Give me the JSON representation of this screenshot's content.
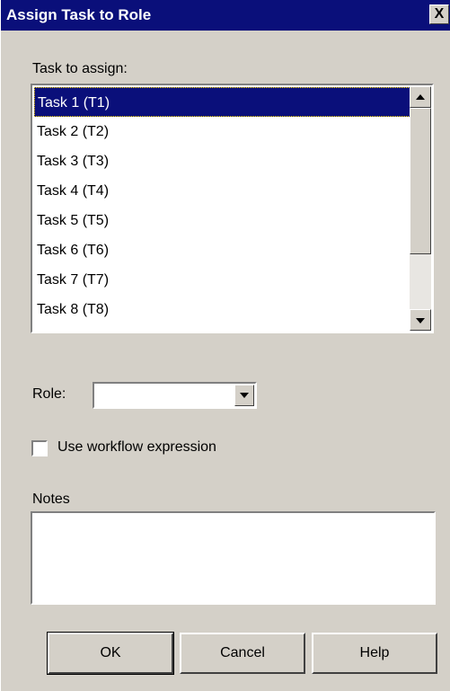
{
  "window": {
    "title": "Assign Task to Role",
    "close_label": "X"
  },
  "task_list": {
    "label": "Task to assign:",
    "items": [
      "Task 1 (T1)",
      "Task 2 (T2)",
      "Task 3 (T3)",
      "Task 4 (T4)",
      "Task 5 (T5)",
      "Task 6 (T6)",
      "Task 7 (T7)",
      "Task 8 (T8)"
    ],
    "selected_index": 0
  },
  "role": {
    "label": "Role:",
    "value": ""
  },
  "workflow": {
    "label": "Use workflow expression",
    "checked": false
  },
  "notes": {
    "label": "Notes",
    "value": ""
  },
  "buttons": {
    "ok": "OK",
    "cancel": "Cancel",
    "help": "Help"
  },
  "colors": {
    "title_bar": "#0a0f7a",
    "selection": "#0a0f7a",
    "dialog_bg": "#d4d0c8"
  }
}
